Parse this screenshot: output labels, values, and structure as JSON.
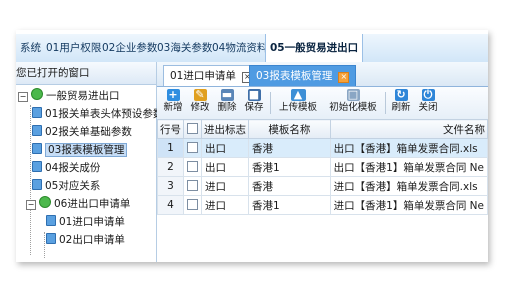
{
  "menu": {
    "items": [
      "系统",
      "01用户权限",
      "02企业参数",
      "03海关参数",
      "04物流资料",
      "05一般贸易进出口"
    ],
    "active_index": 5
  },
  "left_panel": {
    "title": "您已打开的窗口",
    "tree": [
      {
        "label": "一般贸易进出口",
        "level": 0,
        "icon": "folder-group-icon"
      },
      {
        "label": "01报关单表头体预设参数",
        "level": 1,
        "icon": "document-icon"
      },
      {
        "label": "02报关单基础参数",
        "level": 1,
        "icon": "document-icon"
      },
      {
        "label": "03报表模板管理",
        "level": 1,
        "icon": "document-icon",
        "selected": true
      },
      {
        "label": "04报关成份",
        "level": 1,
        "icon": "document-icon"
      },
      {
        "label": "05对应关系",
        "level": 1,
        "icon": "document-icon"
      },
      {
        "label": "06进出口申请单",
        "level": 1,
        "icon": "folder-group-icon"
      },
      {
        "label": "01进口申请单",
        "level": 2,
        "icon": "document-icon"
      },
      {
        "label": "02出口申请单",
        "level": 2,
        "icon": "document-icon"
      }
    ]
  },
  "tabs": [
    {
      "label": "01进口申请单",
      "active": false
    },
    {
      "label": "03报表模板管理",
      "active": true
    }
  ],
  "toolbar": {
    "buttons": [
      {
        "label": "新增",
        "icon": "plus-icon",
        "color": "#2f8ee0"
      },
      {
        "label": "修改",
        "icon": "pencil-icon",
        "color": "#e0a020"
      },
      {
        "label": "删除",
        "icon": "trash-icon",
        "color": "#5a86b8"
      },
      {
        "label": "保存",
        "icon": "save-icon",
        "color": "#3f6fa8"
      },
      {
        "label": "上传模板",
        "icon": "folder-upload-icon",
        "color": "#3d8fd6"
      },
      {
        "label": "初始化模板",
        "icon": "reset-icon",
        "color": "#8aa6c4"
      },
      {
        "label": "刷新",
        "icon": "refresh-icon",
        "color": "#2f86d8"
      },
      {
        "label": "关闭",
        "icon": "power-icon",
        "color": "#2f86d8"
      }
    ]
  },
  "grid": {
    "columns": [
      "行号",
      "",
      "进出标志",
      "模板名称",
      "文件名称"
    ],
    "rows": [
      {
        "num": "1",
        "flag": "出口",
        "name": "香港",
        "file": "出口【香港】箱单发票合同.xls",
        "selected": true
      },
      {
        "num": "2",
        "flag": "出口",
        "name": "香港1",
        "file": "出口【香港1】箱单发票合同 Ne"
      },
      {
        "num": "3",
        "flag": "进口",
        "name": "香港",
        "file": "进口【香港】箱单发票合同.xls"
      },
      {
        "num": "4",
        "flag": "进口",
        "name": "香港1",
        "file": "进口【香港1】箱单发票合同 Ne"
      }
    ]
  }
}
